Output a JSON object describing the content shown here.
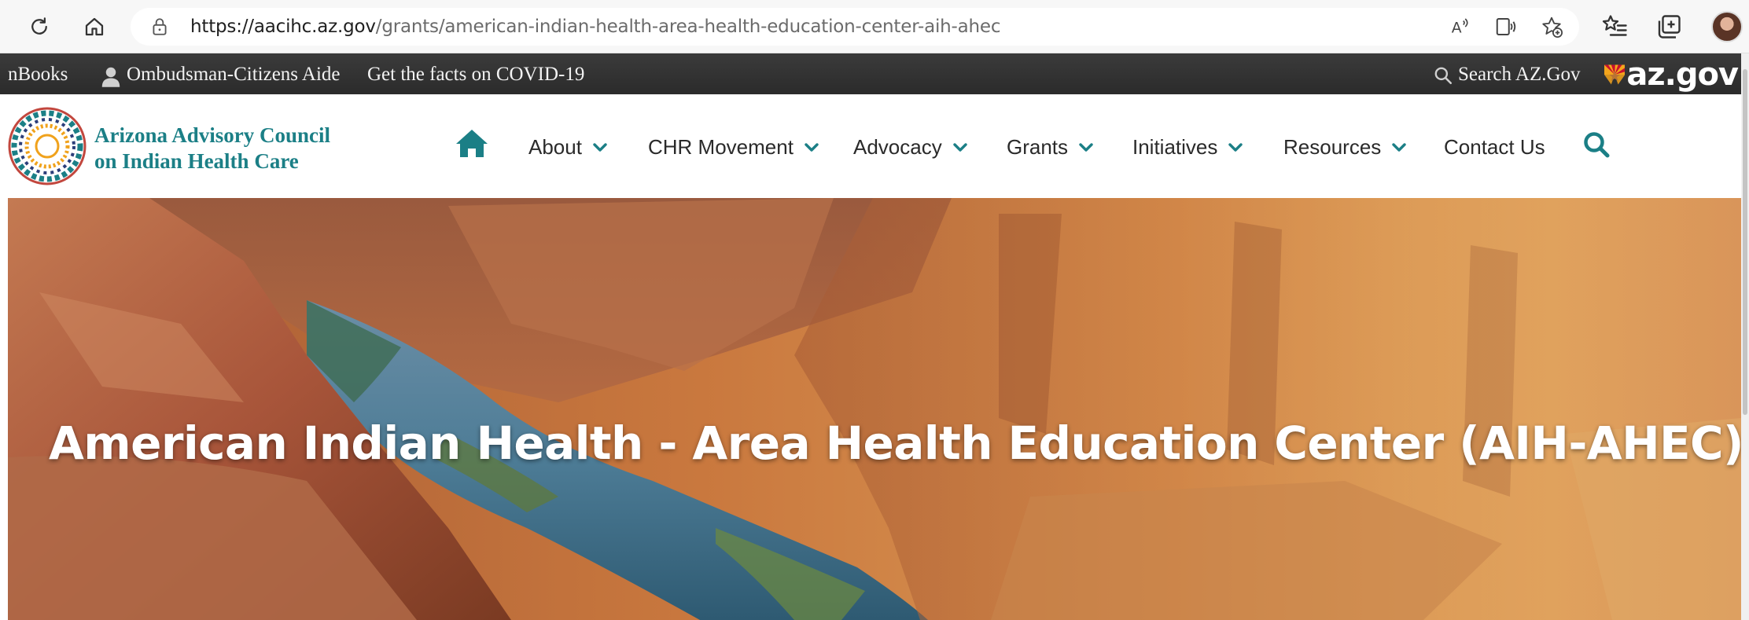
{
  "browser": {
    "url_host": "https://aacihc.az.gov",
    "url_path": "/grants/american-indian-health-area-health-education-center-aih-ahec",
    "icons": [
      "refresh-icon",
      "home-icon",
      "lock-icon",
      "read-aloud-icon",
      "immersive-reader-icon",
      "add-favorite-icon",
      "favorites-icon",
      "collections-icon",
      "profile-avatar"
    ]
  },
  "util_bar": {
    "link_books": "nBooks",
    "link_ombudsman": "Ombudsman-Citizens Aide",
    "link_covid": "Get the facts on COVID-19",
    "search_label": "Search AZ.Gov",
    "logo_text": "az.gov"
  },
  "header": {
    "site_name_line1": "Arizona Advisory Council",
    "site_name_line2": "on Indian Health Care",
    "nav": {
      "about": "About",
      "chr_movement": "CHR Movement",
      "advocacy": "Advocacy",
      "grants": "Grants",
      "initiatives": "Initiatives",
      "resources": "Resources",
      "contact_us": "Contact Us"
    },
    "accent_color": "#1b7f86"
  },
  "hero": {
    "title": "American Indian Health - Area Health Education Center (AIH-AHEC)"
  }
}
